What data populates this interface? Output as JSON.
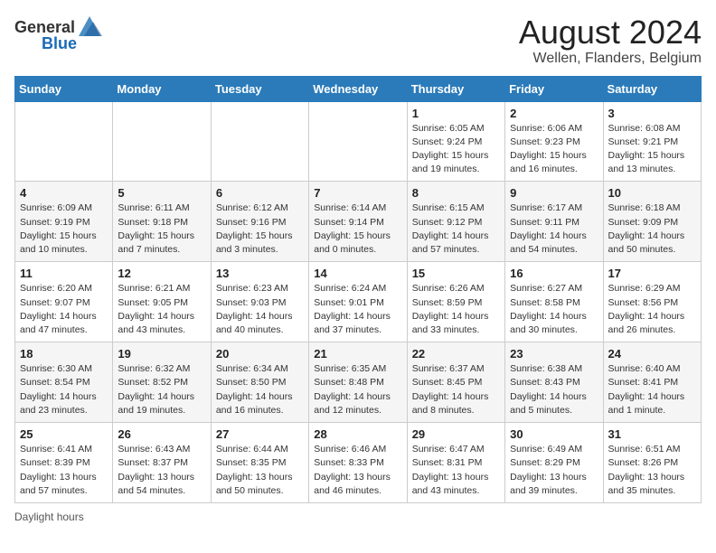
{
  "header": {
    "logo_general": "General",
    "logo_blue": "Blue",
    "month_title": "August 2024",
    "location": "Wellen, Flanders, Belgium"
  },
  "days_of_week": [
    "Sunday",
    "Monday",
    "Tuesday",
    "Wednesday",
    "Thursday",
    "Friday",
    "Saturday"
  ],
  "weeks": [
    [
      {
        "num": "",
        "info": ""
      },
      {
        "num": "",
        "info": ""
      },
      {
        "num": "",
        "info": ""
      },
      {
        "num": "",
        "info": ""
      },
      {
        "num": "1",
        "info": "Sunrise: 6:05 AM\nSunset: 9:24 PM\nDaylight: 15 hours\nand 19 minutes."
      },
      {
        "num": "2",
        "info": "Sunrise: 6:06 AM\nSunset: 9:23 PM\nDaylight: 15 hours\nand 16 minutes."
      },
      {
        "num": "3",
        "info": "Sunrise: 6:08 AM\nSunset: 9:21 PM\nDaylight: 15 hours\nand 13 minutes."
      }
    ],
    [
      {
        "num": "4",
        "info": "Sunrise: 6:09 AM\nSunset: 9:19 PM\nDaylight: 15 hours\nand 10 minutes."
      },
      {
        "num": "5",
        "info": "Sunrise: 6:11 AM\nSunset: 9:18 PM\nDaylight: 15 hours\nand 7 minutes."
      },
      {
        "num": "6",
        "info": "Sunrise: 6:12 AM\nSunset: 9:16 PM\nDaylight: 15 hours\nand 3 minutes."
      },
      {
        "num": "7",
        "info": "Sunrise: 6:14 AM\nSunset: 9:14 PM\nDaylight: 15 hours\nand 0 minutes."
      },
      {
        "num": "8",
        "info": "Sunrise: 6:15 AM\nSunset: 9:12 PM\nDaylight: 14 hours\nand 57 minutes."
      },
      {
        "num": "9",
        "info": "Sunrise: 6:17 AM\nSunset: 9:11 PM\nDaylight: 14 hours\nand 54 minutes."
      },
      {
        "num": "10",
        "info": "Sunrise: 6:18 AM\nSunset: 9:09 PM\nDaylight: 14 hours\nand 50 minutes."
      }
    ],
    [
      {
        "num": "11",
        "info": "Sunrise: 6:20 AM\nSunset: 9:07 PM\nDaylight: 14 hours\nand 47 minutes."
      },
      {
        "num": "12",
        "info": "Sunrise: 6:21 AM\nSunset: 9:05 PM\nDaylight: 14 hours\nand 43 minutes."
      },
      {
        "num": "13",
        "info": "Sunrise: 6:23 AM\nSunset: 9:03 PM\nDaylight: 14 hours\nand 40 minutes."
      },
      {
        "num": "14",
        "info": "Sunrise: 6:24 AM\nSunset: 9:01 PM\nDaylight: 14 hours\nand 37 minutes."
      },
      {
        "num": "15",
        "info": "Sunrise: 6:26 AM\nSunset: 8:59 PM\nDaylight: 14 hours\nand 33 minutes."
      },
      {
        "num": "16",
        "info": "Sunrise: 6:27 AM\nSunset: 8:58 PM\nDaylight: 14 hours\nand 30 minutes."
      },
      {
        "num": "17",
        "info": "Sunrise: 6:29 AM\nSunset: 8:56 PM\nDaylight: 14 hours\nand 26 minutes."
      }
    ],
    [
      {
        "num": "18",
        "info": "Sunrise: 6:30 AM\nSunset: 8:54 PM\nDaylight: 14 hours\nand 23 minutes."
      },
      {
        "num": "19",
        "info": "Sunrise: 6:32 AM\nSunset: 8:52 PM\nDaylight: 14 hours\nand 19 minutes."
      },
      {
        "num": "20",
        "info": "Sunrise: 6:34 AM\nSunset: 8:50 PM\nDaylight: 14 hours\nand 16 minutes."
      },
      {
        "num": "21",
        "info": "Sunrise: 6:35 AM\nSunset: 8:48 PM\nDaylight: 14 hours\nand 12 minutes."
      },
      {
        "num": "22",
        "info": "Sunrise: 6:37 AM\nSunset: 8:45 PM\nDaylight: 14 hours\nand 8 minutes."
      },
      {
        "num": "23",
        "info": "Sunrise: 6:38 AM\nSunset: 8:43 PM\nDaylight: 14 hours\nand 5 minutes."
      },
      {
        "num": "24",
        "info": "Sunrise: 6:40 AM\nSunset: 8:41 PM\nDaylight: 14 hours\nand 1 minute."
      }
    ],
    [
      {
        "num": "25",
        "info": "Sunrise: 6:41 AM\nSunset: 8:39 PM\nDaylight: 13 hours\nand 57 minutes."
      },
      {
        "num": "26",
        "info": "Sunrise: 6:43 AM\nSunset: 8:37 PM\nDaylight: 13 hours\nand 54 minutes."
      },
      {
        "num": "27",
        "info": "Sunrise: 6:44 AM\nSunset: 8:35 PM\nDaylight: 13 hours\nand 50 minutes."
      },
      {
        "num": "28",
        "info": "Sunrise: 6:46 AM\nSunset: 8:33 PM\nDaylight: 13 hours\nand 46 minutes."
      },
      {
        "num": "29",
        "info": "Sunrise: 6:47 AM\nSunset: 8:31 PM\nDaylight: 13 hours\nand 43 minutes."
      },
      {
        "num": "30",
        "info": "Sunrise: 6:49 AM\nSunset: 8:29 PM\nDaylight: 13 hours\nand 39 minutes."
      },
      {
        "num": "31",
        "info": "Sunrise: 6:51 AM\nSunset: 8:26 PM\nDaylight: 13 hours\nand 35 minutes."
      }
    ]
  ],
  "footer": {
    "note": "Daylight hours"
  }
}
